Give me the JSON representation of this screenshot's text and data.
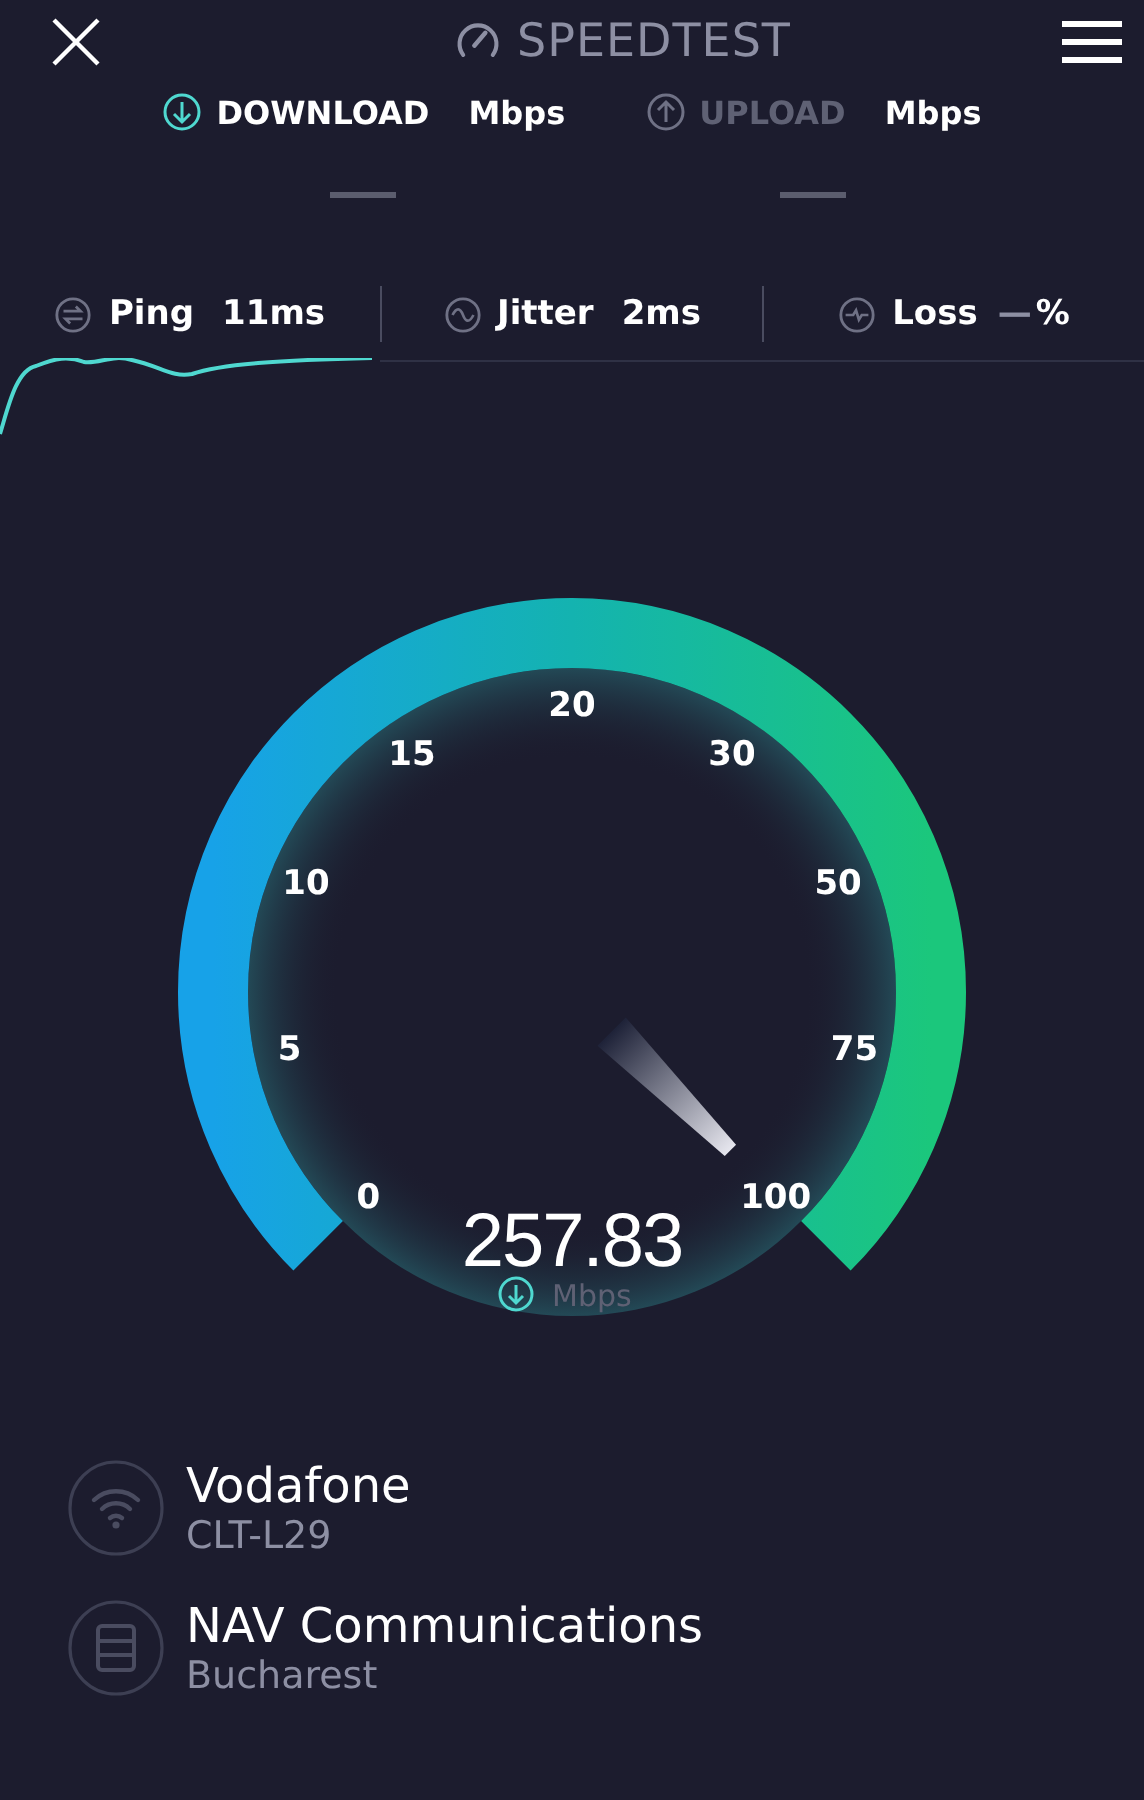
{
  "header": {
    "title": "SPEEDTEST"
  },
  "tabs": [
    {
      "label": "DOWNLOAD",
      "unit": "Mbps",
      "selected": true
    },
    {
      "label": "UPLOAD",
      "unit": "Mbps",
      "selected": false
    }
  ],
  "metrics": [
    {
      "kind": "ping",
      "label": "Ping",
      "value": "11ms",
      "selected": true
    },
    {
      "kind": "jitter",
      "label": "Jitter",
      "value": "2ms",
      "selected": false
    },
    {
      "kind": "loss",
      "label": "Loss",
      "value": "—",
      "unit": "%",
      "selected": false
    }
  ],
  "gauge": {
    "scale": [
      "0",
      "5",
      "10",
      "15",
      "20",
      "30",
      "50",
      "75",
      "100"
    ],
    "reading": "257.83",
    "unit": "Mbps"
  },
  "providers": [
    {
      "kind": "wifi",
      "name": "Vodafone",
      "detail": "CLT-L29"
    },
    {
      "kind": "server",
      "name": "NAV Communications",
      "detail": "Bucharest"
    }
  ]
}
